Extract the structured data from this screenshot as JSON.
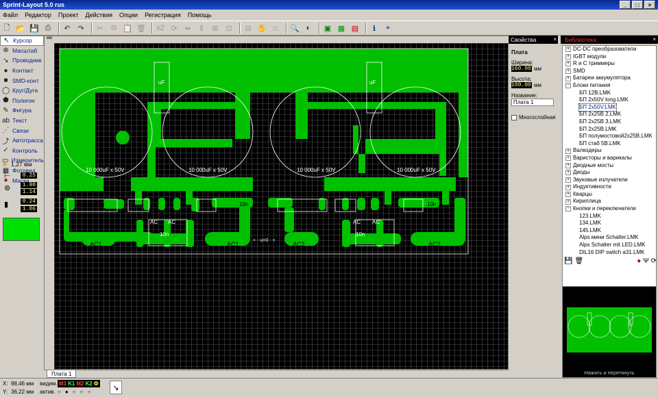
{
  "window": {
    "title": "Sprint-Layout 5.0 rus"
  },
  "menu": [
    "Файл",
    "Редактор",
    "Проект",
    "Действия",
    "Опции",
    "Регистрация",
    "Помощь"
  ],
  "left_tools": [
    {
      "label": "Курсор",
      "icon": "cursor-icon",
      "glyph": "↖",
      "active": true
    },
    {
      "label": "Масштаб",
      "icon": "zoom-icon",
      "glyph": "⊕",
      "active": false
    },
    {
      "label": "Проводник",
      "icon": "track-icon",
      "glyph": "↘",
      "active": false
    },
    {
      "label": "Контакт",
      "icon": "pad-icon",
      "glyph": "●",
      "active": false
    },
    {
      "label": "SMD-конт",
      "icon": "smd-pad-icon",
      "glyph": "■",
      "active": false
    },
    {
      "label": "Круг/Дуга",
      "icon": "circle-icon",
      "glyph": "◯",
      "active": false
    },
    {
      "label": "Полигон",
      "icon": "polygon-icon",
      "glyph": "⬟",
      "active": false
    },
    {
      "label": "Фигура",
      "icon": "shape-icon",
      "glyph": "✎",
      "active": false
    },
    {
      "label": "Текст",
      "icon": "text-icon",
      "glyph": "ab",
      "active": false
    },
    {
      "label": "Связи",
      "icon": "connections-icon",
      "glyph": "⋰",
      "active": false
    },
    {
      "label": "Автотрасса",
      "icon": "autoroute-icon",
      "glyph": "⤴",
      "active": false
    },
    {
      "label": "Контроль",
      "icon": "drc-icon",
      "glyph": "✓",
      "active": false
    },
    {
      "label": "Измеритель",
      "icon": "ruler-icon",
      "glyph": "▭",
      "active": false
    },
    {
      "label": "Фотовид",
      "icon": "photo-view-icon",
      "glyph": "▦",
      "active": false
    },
    {
      "label": "Маска",
      "icon": "mask-icon",
      "glyph": "●",
      "active": false
    }
  ],
  "grid": {
    "label": "1,27 мм"
  },
  "track_fields": [
    "0.25",
    "1.90",
    "1.14",
    "0.24",
    "1.06"
  ],
  "colors": {
    "copper": "#00c000",
    "board_bg": "#000000",
    "grid": "#9a9a9a",
    "swatch": "#00e000",
    "panel_head": "#000000",
    "lib_head_text": "#ff3030"
  },
  "canvas": {
    "ruler_unit": "мм",
    "labels": {
      "uf": "uF",
      "cap1": "10 000uF x 50V",
      "cap2": "10 000uF x 50V",
      "cap3": "10 000uF x 50V",
      "cap4": "10 000uF x 50V",
      "n1": "10n",
      "n2": "10n",
      "n3": "10n",
      "n4": "10n",
      "n5": "10n",
      "n6": "10n",
      "ac1a": "AC1",
      "ac1b": "AC1",
      "ac2a": "AC2",
      "ac2b": "AC2",
      "ac_a": "AC",
      "ac_b": "AC",
      "ac_c": "AC",
      "ac_d": "AC",
      "mid": "+ - u=0 - +"
    }
  },
  "tab": {
    "label": "Плата 1"
  },
  "status": {
    "x_label": "X:",
    "x_value": "98,46 мм",
    "y_label": "Y:",
    "y_value": "36,22 мм",
    "visible_label": "видим.",
    "active_label": "актив.",
    "layers": [
      "M1",
      "K1",
      "M2",
      "K2",
      "Ф"
    ]
  },
  "properties": {
    "title": "Свойства",
    "section": "Плата",
    "width_label": "Ширина:",
    "width_value": "160.00",
    "height_label": "Высота:",
    "height_value": "100.00",
    "unit": "мм",
    "name_label": "Название:",
    "name_value": "Плата 1",
    "multilayer_label": "Многослойная"
  },
  "library": {
    "title": "Библиотека",
    "items": [
      {
        "label": "DC-DC преобразователи",
        "level": 0,
        "expanded": false
      },
      {
        "label": "IGBT модули",
        "level": 0,
        "expanded": false
      },
      {
        "label": "R и C триммеры",
        "level": 0,
        "expanded": false
      },
      {
        "label": "SMD",
        "level": 0,
        "expanded": false
      },
      {
        "label": "Батареи аккумулятора",
        "level": 0,
        "expanded": false
      },
      {
        "label": "Блоки питания",
        "level": 0,
        "expanded": true
      },
      {
        "label": "БП 12В.LMK",
        "level": 1
      },
      {
        "label": "БП 2x50V long.LMK",
        "level": 1
      },
      {
        "label": "БП 2x50V.LMK",
        "level": 1,
        "selected": true
      },
      {
        "label": "БП 2x25В 2.LMK",
        "level": 1
      },
      {
        "label": "БП 2x25В 3.LMK",
        "level": 1
      },
      {
        "label": "БП 2x25В.LMK",
        "level": 1
      },
      {
        "label": "БП полумостовой2x25В.LMK",
        "level": 1
      },
      {
        "label": "БП стаб 5В.LMK",
        "level": 1
      },
      {
        "label": "Валкодеры",
        "level": 0,
        "expanded": false
      },
      {
        "label": "Варисторы и варикалы",
        "level": 0,
        "expanded": false
      },
      {
        "label": "Диодные мосты",
        "level": 0,
        "expanded": false
      },
      {
        "label": "Диоды",
        "level": 0,
        "expanded": false
      },
      {
        "label": "Звуковые излучатели",
        "level": 0,
        "expanded": false
      },
      {
        "label": "Индуктивности",
        "level": 0,
        "expanded": false
      },
      {
        "label": "Кварцы",
        "level": 0,
        "expanded": false
      },
      {
        "label": "Кириллица",
        "level": 0,
        "expanded": false
      },
      {
        "label": "Кнопки и переключатели",
        "level": 0,
        "expanded": true
      },
      {
        "label": "123.LMK",
        "level": 1
      },
      {
        "label": "134.LMK",
        "level": 1
      },
      {
        "label": "145.LMK",
        "level": 1
      },
      {
        "label": "Alps мини Schalter.LMK",
        "level": 1
      },
      {
        "label": "Alps Schalter mit LED.LMK",
        "level": 1
      },
      {
        "label": "DIL16 DIP switch a31.LMK",
        "level": 1
      }
    ],
    "preview_hint": "Нажать и перетянуть"
  }
}
